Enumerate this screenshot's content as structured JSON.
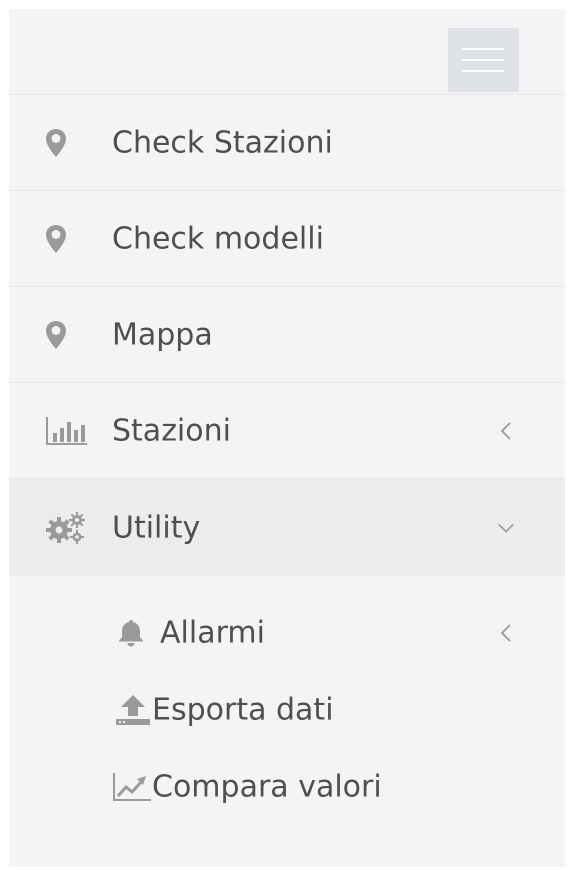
{
  "sidebar": {
    "toggle_icon": "hamburger-icon",
    "items": [
      {
        "label": "Check Stazioni",
        "icon": "map-marker-icon"
      },
      {
        "label": "Check modelli",
        "icon": "map-marker-icon"
      },
      {
        "label": "Mappa",
        "icon": "map-marker-icon"
      },
      {
        "label": "Stazioni",
        "icon": "bar-chart-icon",
        "chevron": "chevron-left-icon"
      },
      {
        "label": "Utility",
        "icon": "gears-icon",
        "chevron": "chevron-down-icon",
        "expanded": true
      }
    ],
    "submenu": [
      {
        "label": "Allarmi",
        "icon": "bell-icon",
        "chevron": "chevron-left-icon"
      },
      {
        "label": "Esporta dati",
        "icon": "upload-icon"
      },
      {
        "label": "Compara valori",
        "icon": "line-chart-icon"
      }
    ]
  },
  "colors": {
    "sidebar_bg": "#f4f4f4",
    "active_bg": "#ececec",
    "toggle_bg": "#dfe3e8",
    "icon": "#9a9a9a",
    "text": "#4f4f4f"
  }
}
